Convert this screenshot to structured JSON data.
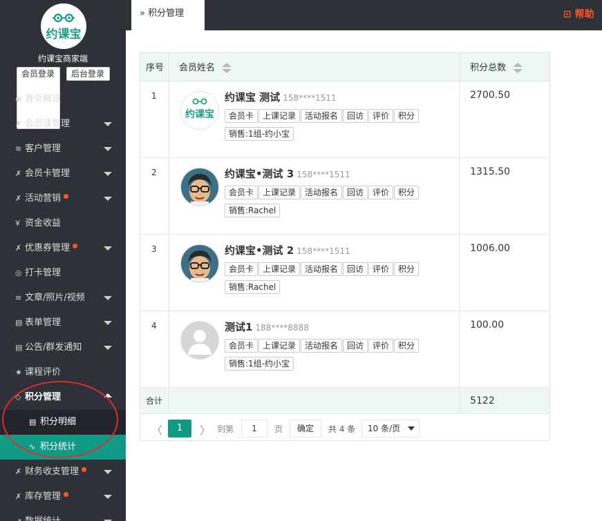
{
  "sidebar": {
    "shop_name": "约课宝商家端",
    "logo_text": "约课宝",
    "member_login": "会员登录",
    "backend_login": "后台登录",
    "items": [
      {
        "label": "首页概览",
        "icon": "globe-icon",
        "glyph": "⊕",
        "caret": false,
        "dot": false
      },
      {
        "label": "会员课管理",
        "icon": "wrench-icon",
        "glyph": "✗",
        "caret": true,
        "dot": false
      },
      {
        "label": "客户管理",
        "icon": "layers-icon",
        "glyph": "≋",
        "caret": true,
        "dot": false
      },
      {
        "label": "会员卡管理",
        "icon": "wrench-icon",
        "glyph": "✗",
        "caret": true,
        "dot": false
      },
      {
        "label": "活动营销",
        "icon": "wrench-icon",
        "glyph": "✗",
        "caret": true,
        "dot": true
      },
      {
        "label": "资金收益",
        "icon": "yen-icon",
        "glyph": "¥",
        "caret": false,
        "dot": false
      },
      {
        "label": "优惠券管理",
        "icon": "wrench-icon",
        "glyph": "✗",
        "caret": true,
        "dot": true
      },
      {
        "label": "打卡管理",
        "icon": "location-icon",
        "glyph": "◎",
        "caret": false,
        "dot": false
      },
      {
        "label": "文章/照片/视频",
        "icon": "text-icon",
        "glyph": "≡",
        "caret": true,
        "dot": false
      },
      {
        "label": "表单管理",
        "icon": "form-icon",
        "glyph": "▤",
        "caret": true,
        "dot": false
      },
      {
        "label": "公告/群发通知",
        "icon": "form-icon",
        "glyph": "▤",
        "caret": true,
        "dot": false
      },
      {
        "label": "课程评价",
        "icon": "star-icon",
        "glyph": "★",
        "caret": false,
        "dot": false
      }
    ],
    "open_item": {
      "label": "积分管理",
      "icon": "diamond-icon",
      "glyph": "◇"
    },
    "sub_items": [
      {
        "label": "积分明细",
        "icon": "table-icon",
        "glyph": "▤",
        "active": false
      },
      {
        "label": "积分统计",
        "icon": "pulse-icon",
        "glyph": "∿",
        "active": true
      }
    ],
    "after_items": [
      {
        "label": "财务收支管理",
        "icon": "wrench-icon",
        "glyph": "✗",
        "caret": true,
        "dot": true
      },
      {
        "label": "库存管理",
        "icon": "wrench-icon",
        "glyph": "✗",
        "caret": true,
        "dot": true
      },
      {
        "label": "数据统计",
        "icon": "chart-icon",
        "glyph": "↗",
        "caret": true,
        "dot": false
      }
    ]
  },
  "topbar": {
    "tab_label": "积分管理",
    "tab_icon": "»",
    "help_label": "帮助"
  },
  "table": {
    "headers": {
      "index": "序号",
      "name": "会员姓名",
      "points": "积分总数"
    },
    "rows": [
      {
        "index": "1",
        "name": "约课宝 测试",
        "phone": "158****1511",
        "avatar": "brand",
        "points": "2700.50",
        "tags": [
          "会员卡",
          "上课记录",
          "活动报名",
          "回访",
          "评价",
          "积分"
        ],
        "sales": "销售:1组-约小宝"
      },
      {
        "index": "2",
        "name": "约课宝•测试 3",
        "phone": "158****1511",
        "avatar": "cartoon",
        "points": "1315.50",
        "tags": [
          "会员卡",
          "上课记录",
          "活动报名",
          "回访",
          "评价",
          "积分"
        ],
        "sales": "销售:Rachel"
      },
      {
        "index": "3",
        "name": "约课宝•测试 2",
        "phone": "158****1511",
        "avatar": "cartoon",
        "points": "1006.00",
        "tags": [
          "会员卡",
          "上课记录",
          "活动报名",
          "回访",
          "评价",
          "积分"
        ],
        "sales": "销售:Rachel"
      },
      {
        "index": "4",
        "name": "测试1",
        "phone": "188****8888",
        "avatar": "default",
        "points": "100.00",
        "tags": [
          "会员卡",
          "上课记录",
          "活动报名",
          "回访",
          "评价",
          "积分"
        ],
        "sales": "销售:1组-约小宝"
      }
    ],
    "total_label": "合计",
    "total_points": "5122"
  },
  "pager": {
    "prev": "〈",
    "current": "1",
    "next": "〉",
    "goto_label": "到第",
    "goto_value": "1",
    "page_label": "页",
    "ok_label": "确定",
    "total": "共 4 条",
    "page_size": "10 条/页"
  },
  "colors": {
    "accent": "#119b87",
    "sidebar_bg": "#2f3139",
    "alert": "#ff5722",
    "annotation": "#e02c2c"
  }
}
